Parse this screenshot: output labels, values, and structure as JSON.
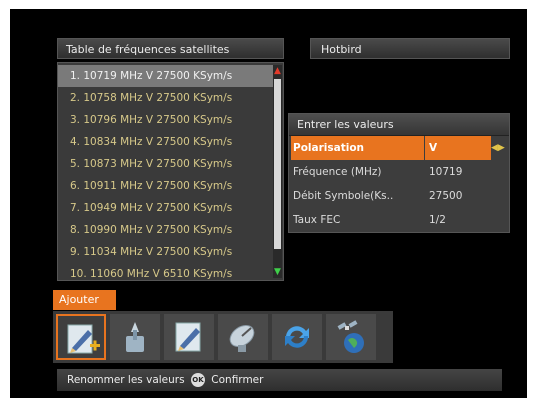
{
  "list": {
    "title": "Table de fréquences satellites",
    "items": [
      "1. 10719 MHz V 27500 KSym/s",
      "2. 10758 MHz V 27500 KSym/s",
      "3. 10796 MHz V 27500 KSym/s",
      "4. 10834 MHz V 27500 KSym/s",
      "5. 10873 MHz V 27500 KSym/s",
      "6. 10911 MHz V 27500 KSym/s",
      "7. 10949 MHz V 27500 KSym/s",
      "8. 10990 MHz V 27500 KSym/s",
      "9. 11034 MHz V 27500 KSym/s",
      "10. 11060 MHz V 6510 KSym/s"
    ],
    "selected_index": 0
  },
  "satellite": {
    "name": "Hotbird"
  },
  "dialog": {
    "title": "Entrer les valeurs",
    "rows": [
      {
        "label": "Polarisation",
        "value": "V"
      },
      {
        "label": "Fréquence (MHz)",
        "value": "10719"
      },
      {
        "label": "Débit Symbole(Ks..",
        "value": "27500"
      },
      {
        "label": "Taux FEC",
        "value": "1/2"
      }
    ]
  },
  "toolbar": {
    "selected_label": "Ajouter",
    "icons": [
      "edit-add-icon",
      "tools-icon",
      "edit-icon",
      "satellite-dish-icon",
      "refresh-icon",
      "satellite-earth-icon"
    ]
  },
  "statusbar": {
    "hint_text": "Renommer les valeurs",
    "ok_badge": "OK",
    "confirm_text": "Confirmer"
  },
  "colors": {
    "accent": "#e8741f",
    "list_text": "#d7c98a",
    "background": "#000000"
  }
}
